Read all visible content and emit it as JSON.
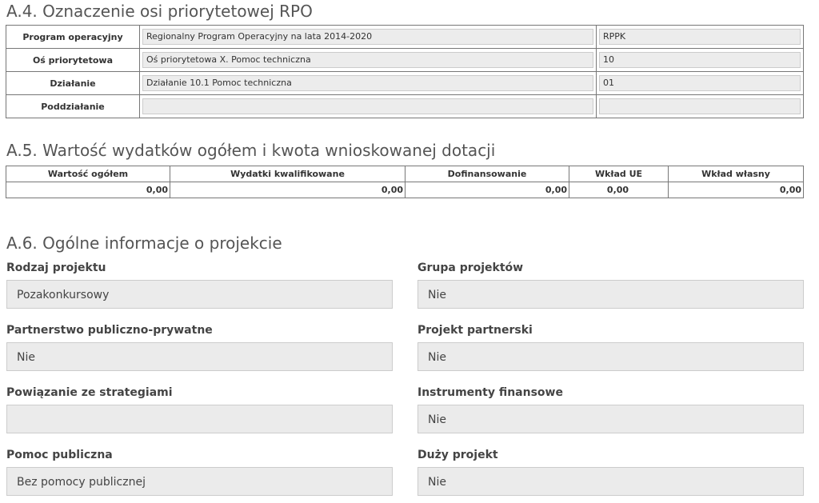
{
  "a4": {
    "title": "A.4. Oznaczenie osi priorytetowej RPO",
    "rows": [
      {
        "label": "Program operacyjny",
        "value": "Regionalny Program Operacyjny na lata 2014-2020",
        "code": "RPPK"
      },
      {
        "label": "Oś priorytetowa",
        "value": "Oś priorytetowa X. Pomoc techniczna",
        "code": "10"
      },
      {
        "label": "Działanie",
        "value": "Działanie 10.1 Pomoc techniczna",
        "code": "01"
      },
      {
        "label": "Poddziałanie",
        "value": "",
        "code": ""
      }
    ]
  },
  "a5": {
    "title": "A.5. Wartość wydatków ogółem i kwota wnioskowanej dotacji",
    "headers": [
      "Wartość ogółem",
      "Wydatki kwalifikowane",
      "Dofinansowanie",
      "Wkład UE",
      "Wkład własny"
    ],
    "values": [
      "0,00",
      "0,00",
      "0,00",
      "0,00",
      "0,00"
    ]
  },
  "a6": {
    "title": "A.6. Ogólne informacje o projekcie",
    "fields": [
      {
        "label": "Rodzaj projektu",
        "value": "Pozakonkursowy"
      },
      {
        "label": "Grupa projektów",
        "value": "Nie"
      },
      {
        "label": "Partnerstwo publiczno-prywatne",
        "value": "Nie"
      },
      {
        "label": "Projekt partnerski",
        "value": "Nie"
      },
      {
        "label": "Powiązanie ze strategiami",
        "value": ""
      },
      {
        "label": "Instrumenty finansowe",
        "value": "Nie"
      },
      {
        "label": "Pomoc publiczna",
        "value": "Bez pomocy publicznej"
      },
      {
        "label": "Duży projekt",
        "value": "Nie"
      }
    ]
  }
}
